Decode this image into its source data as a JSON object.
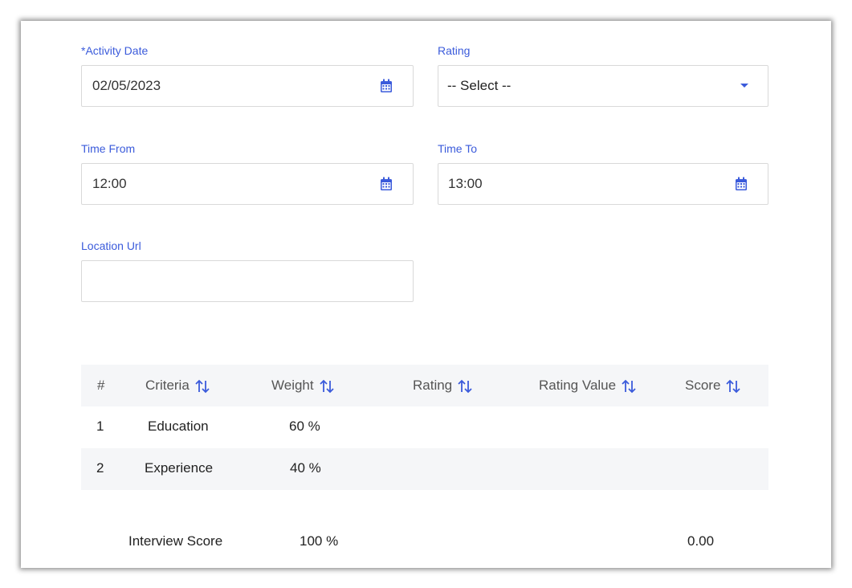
{
  "form": {
    "activity_date": {
      "label": "*Activity Date",
      "value": "02/05/2023"
    },
    "rating": {
      "label": "Rating",
      "value": "-- Select --"
    },
    "time_from": {
      "label": "Time From",
      "value": "12:00"
    },
    "time_to": {
      "label": "Time To",
      "value": "13:00"
    },
    "location_url": {
      "label": "Location Url",
      "value": ""
    }
  },
  "table": {
    "columns": [
      "#",
      "Criteria",
      "Weight",
      "Rating",
      "Rating Value",
      "Score"
    ],
    "rows": [
      {
        "num": "1",
        "criteria": "Education",
        "weight": "60 %"
      },
      {
        "num": "2",
        "criteria": "Experience",
        "weight": "40 %"
      }
    ],
    "footer": {
      "label": "Interview Score",
      "weight": "100 %",
      "score": "0.00"
    }
  },
  "colors": {
    "accent": "#3b5bdb",
    "border": "#d9d9d9",
    "stripe": "#f5f6f8"
  },
  "icons": {
    "calendar": "calendar-icon",
    "sort": "sort-icon",
    "dropdown": "chevron-down-icon"
  }
}
